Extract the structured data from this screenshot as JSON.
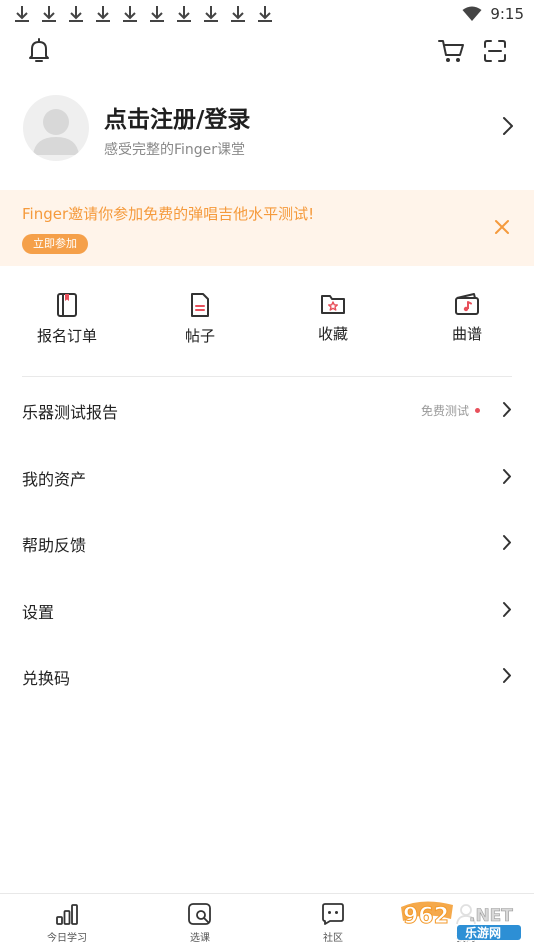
{
  "status_bar": {
    "time": "9:15",
    "download_count": 10
  },
  "header": {
    "bell_icon": "bell-icon",
    "cart_icon": "cart-icon",
    "scan_icon": "scan-icon"
  },
  "profile": {
    "title": "点击注册/登录",
    "subtitle": "感受完整的Finger课堂"
  },
  "banner": {
    "text": "Finger邀请你参加免费的弹唱吉他水平测试!",
    "button_label": "立即参加",
    "accent_color": "#f59a3c",
    "background_color": "#fff4ea"
  },
  "quick_actions": [
    {
      "label": "报名订单",
      "icon": "order-book-icon"
    },
    {
      "label": "帖子",
      "icon": "post-document-icon"
    },
    {
      "label": "收藏",
      "icon": "favorite-folder-icon"
    },
    {
      "label": "曲谱",
      "icon": "music-score-icon"
    }
  ],
  "menu": [
    {
      "label": "乐器测试报告",
      "extra": "免费测试"
    },
    {
      "label": "我的资产"
    },
    {
      "label": "帮助反馈"
    },
    {
      "label": "设置"
    },
    {
      "label": "兑换码"
    }
  ],
  "bottom_nav": [
    {
      "label": "今日学习",
      "icon": "chart-bars-icon"
    },
    {
      "label": "选课",
      "icon": "search-course-icon"
    },
    {
      "label": "社区",
      "icon": "community-chat-icon"
    },
    {
      "label": "我的",
      "icon": "profile-icon"
    }
  ],
  "watermark": {
    "line1": "962 NET",
    "line2": "乐游网"
  }
}
